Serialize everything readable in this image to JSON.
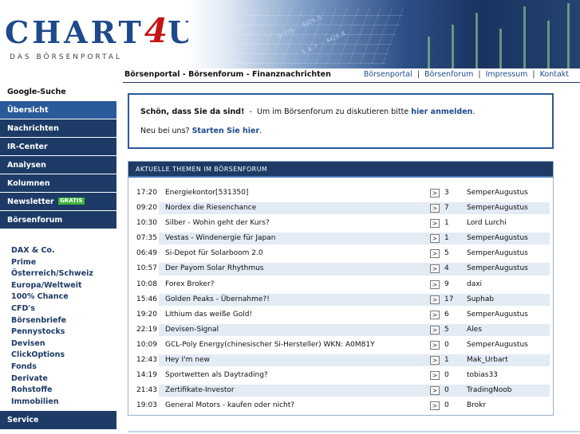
{
  "logo": {
    "main_prefix": "CHART",
    "main_four": "4",
    "main_u": "U",
    "subtitle": "DAS BÖRSENPORTAL"
  },
  "header": {
    "title": "Börsenportal - Börsenforum - Finanznachrichten",
    "links": [
      "Börsenportal",
      "Börsenforum",
      "Impressum",
      "Kontakt"
    ],
    "separator": "|"
  },
  "sidebar": {
    "items": [
      {
        "label": "Google-Suche"
      },
      {
        "label": "Übersicht"
      },
      {
        "label": "Nachrichten"
      },
      {
        "label": "IR-Center"
      },
      {
        "label": "Analysen"
      },
      {
        "label": "Kolumnen"
      },
      {
        "label": "Newsletter",
        "badge": "GRATIS"
      },
      {
        "label": "Börsenforum"
      }
    ],
    "sub_items": [
      "DAX & Co.",
      "Prime",
      "Österreich/Schweiz",
      "Europa/Weltweit",
      "100% Chance",
      "CFD's",
      "Börsenbriefe",
      "Pennystocks",
      "Devisen",
      "ClickOptions",
      "Fonds",
      "Derivate",
      "Rohstoffe",
      "Immobilien"
    ],
    "service": "Service"
  },
  "welcome": {
    "greeting": "Schön, dass Sie da sind!",
    "dash": "-",
    "text_before": "Um im Börsenforum zu diskutieren bitte",
    "login_link": "hier anmelden",
    "text_after": ".",
    "new_text": "Neu bei uns?",
    "start_link": "Starten Sie hier",
    "new_after": "."
  },
  "topics": {
    "heading": "AKTUELLE THEMEN IM BÖRSENFORUM",
    "arrow": ">",
    "rows": [
      {
        "time": "17:20",
        "title": "Energiekontor[531350]",
        "count": "3",
        "user": "SemperAugustus"
      },
      {
        "time": "09:20",
        "title": "Nordex die Riesenchance",
        "count": "7",
        "user": "SemperAugustus"
      },
      {
        "time": "10:30",
        "title": "Silber - Wohin geht der Kurs?",
        "count": "1",
        "user": "Lord Lurchi"
      },
      {
        "time": "07:35",
        "title": "Vestas - Windenergie für Japan",
        "count": "1",
        "user": "SemperAugustus"
      },
      {
        "time": "06:49",
        "title": "Si-Depot für Solarboom 2.0",
        "count": "5",
        "user": "SemperAugustus"
      },
      {
        "time": "10:57",
        "title": "Der Payom Solar Rhythmus",
        "count": "4",
        "user": "SemperAugustus"
      },
      {
        "time": "10:08",
        "title": "Forex Broker?",
        "count": "9",
        "user": "daxi"
      },
      {
        "time": "15:46",
        "title": "Golden Peaks - Übernahme?!",
        "count": "17",
        "user": "Suphab"
      },
      {
        "time": "19:20",
        "title": "Lithium das weiße Gold!",
        "count": "6",
        "user": "SemperAugustus"
      },
      {
        "time": "22:19",
        "title": "Devisen-Signal",
        "count": "5",
        "user": "Ales"
      },
      {
        "time": "10:09",
        "title": "GCL-Poly Energy(chinesischer Si-Hersteller) WKN: A0M81Y",
        "count": "0",
        "user": "SemperAugustus"
      },
      {
        "time": "12:43",
        "title": "Hey I'm new",
        "count": "1",
        "user": "Mak_Urbart"
      },
      {
        "time": "14:19",
        "title": "Sportwetten als Daytrading?",
        "count": "0",
        "user": "tobias33"
      },
      {
        "time": "21:43",
        "title": "Zertifikate-Investor",
        "count": "0",
        "user": "TradingNoob"
      },
      {
        "time": "19:03",
        "title": "General Motors - kaufen oder nicht?",
        "count": "0",
        "user": "Brokr"
      }
    ]
  }
}
